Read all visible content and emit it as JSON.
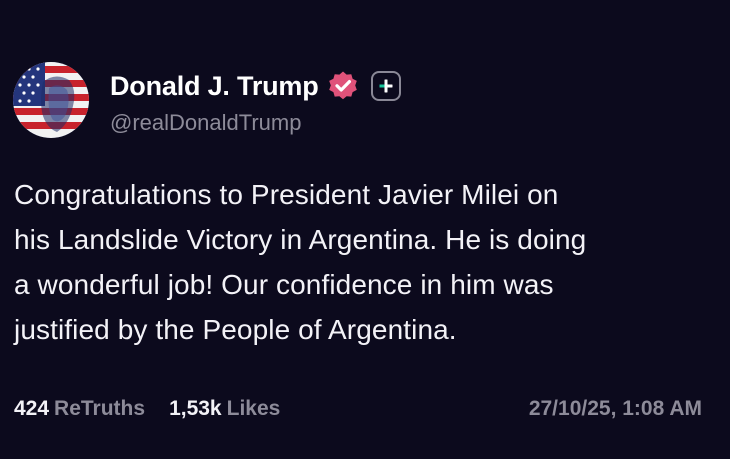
{
  "post": {
    "author": {
      "display_name": "Donald J. Trump",
      "handle": "@realDonaldTrump",
      "verified_icon": "verified-badge-icon",
      "plus_icon": "plus-icon"
    },
    "text": "Congratulations to President Javier Milei on\nhis Landslide Victory in Argentina. He is doing\na wonderful job! Our confidence in him was\njustified by the People of Argentina.",
    "stats": {
      "retruths_count": "424",
      "retruths_label": "ReTruths",
      "likes_count": "1,53k",
      "likes_label": "Likes"
    },
    "timestamp": "27/10/25, 1:08 AM"
  },
  "colors": {
    "background": "#0c0a1d",
    "muted_text": "#8d8b99",
    "verified_badge": "#e0527a",
    "plus_accent": "#18c49a"
  }
}
